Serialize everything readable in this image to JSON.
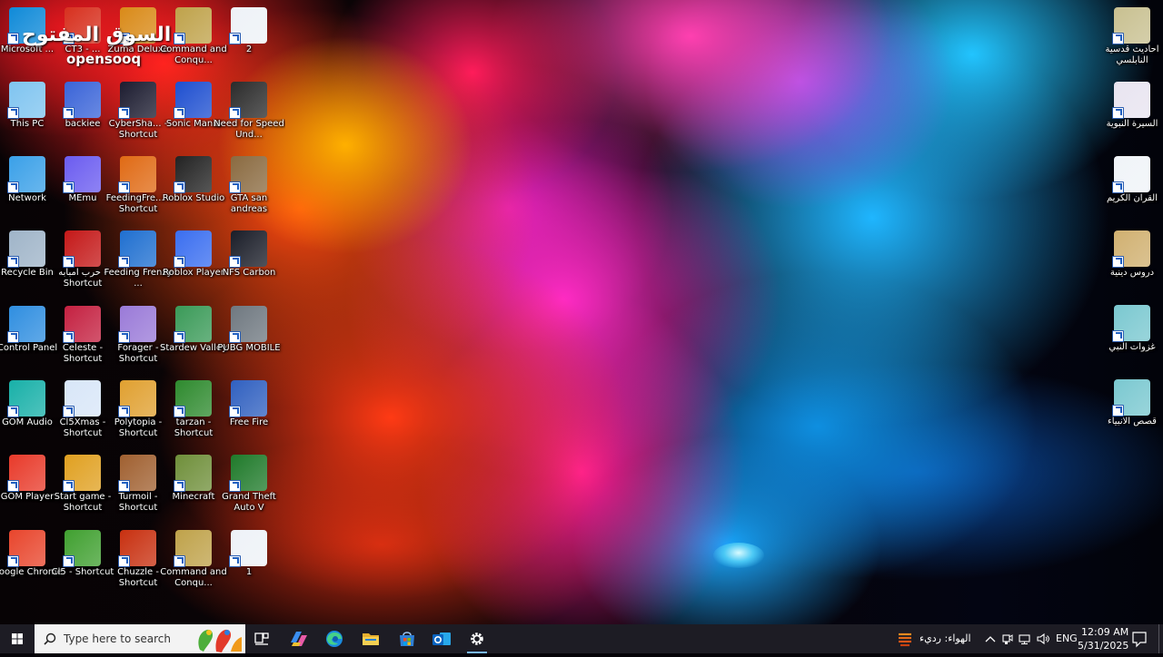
{
  "watermark": {
    "arabic": "السوق المفتوح",
    "latin": "opensooq"
  },
  "desktop": {
    "icons": [
      {
        "label": "Microsoft ...",
        "color": "#0f8ad8"
      },
      {
        "label": "CT3 - ...",
        "color": "#d7301e"
      },
      {
        "label": "Zuma Deluxe",
        "color": "#d98a18"
      },
      {
        "label": "Command and Conqu...",
        "color": "#bfa24a"
      },
      {
        "label": "2",
        "color": "#eef2f7"
      },
      {
        "label": "This PC",
        "color": "#7fc4f0"
      },
      {
        "label": "backiee",
        "color": "#3a64d8"
      },
      {
        "label": "CyberSha... - Shortcut",
        "color": "#1c1c30"
      },
      {
        "label": "Sonic Mania",
        "color": "#1e4fd0"
      },
      {
        "label": "Need for Speed Und...",
        "color": "#2b2b2b"
      },
      {
        "label": "Network",
        "color": "#3aa0e8"
      },
      {
        "label": "MEmu",
        "color": "#6b5cf0"
      },
      {
        "label": "FeedingFre... - Shortcut",
        "color": "#e06a14"
      },
      {
        "label": "Roblox Studio",
        "color": "#222222"
      },
      {
        "label": "GTA san andreas",
        "color": "#8a6a40"
      },
      {
        "label": "Recycle Bin",
        "color": "#9fb4c8"
      },
      {
        "label": "حرب امبابه - Shortcut",
        "color": "#c41818"
      },
      {
        "label": "Feeding Frenzy ...",
        "color": "#1f6fd0"
      },
      {
        "label": "Roblox Player",
        "color": "#3a6ef0"
      },
      {
        "label": "NFS Carbon",
        "color": "#1a1d28"
      },
      {
        "label": "Control Panel",
        "color": "#2f8ee0"
      },
      {
        "label": "Celeste - Shortcut",
        "color": "#c42040"
      },
      {
        "label": "Forager - Shortcut",
        "color": "#9a7ad8"
      },
      {
        "label": "Stardew Valley",
        "color": "#3a9a58"
      },
      {
        "label": "PUBG MOBILE",
        "color": "#6f7880"
      },
      {
        "label": "GOM Audio",
        "color": "#18b0a8"
      },
      {
        "label": "Cl5Xmas - Shortcut",
        "color": "#d8e6f8"
      },
      {
        "label": "Polytopia - Shortcut",
        "color": "#e0a030"
      },
      {
        "label": "tarzan - Shortcut",
        "color": "#2e8a2e"
      },
      {
        "label": "Free Fire",
        "color": "#3060c0"
      },
      {
        "label": "GOM Player",
        "color": "#e83a2a"
      },
      {
        "label": "Start game - Shortcut",
        "color": "#e0a020"
      },
      {
        "label": "Turmoil - Shortcut",
        "color": "#a06030"
      },
      {
        "label": "Minecraft",
        "color": "#6f8f3a"
      },
      {
        "label": "Grand Theft Auto V",
        "color": "#1f7a2a"
      },
      {
        "label": "Google Chrome",
        "color": "#e8452c"
      },
      {
        "label": "Cl5 - Shortcut",
        "color": "#40a030"
      },
      {
        "label": "Chuzzle - Shortcut",
        "color": "#c83010"
      },
      {
        "label": "Command and Conqu...",
        "color": "#bfa24a"
      },
      {
        "label": "1",
        "color": "#eef2f7"
      }
    ],
    "right_icons": [
      {
        "label": "احاديث قدسية النابلسي",
        "color": "#c8c090"
      },
      {
        "label": "السيرة النبوية",
        "color": "#e8e4f0"
      },
      {
        "label": "القرآن الكريم",
        "color": "#f0f4f8"
      },
      {
        "label": "دروس دينية",
        "color": "#d0b070"
      },
      {
        "label": "غزوات النبي",
        "color": "#7ac8d0"
      },
      {
        "label": "قصص الانبياء",
        "color": "#7ac8d0"
      }
    ]
  },
  "taskbar": {
    "search_placeholder": "Type here to search",
    "pins": [
      {
        "name": "task-view-icon"
      },
      {
        "name": "copilot-icon"
      },
      {
        "name": "edge-icon"
      },
      {
        "name": "file-explorer-icon"
      },
      {
        "name": "microsoft-store-icon"
      },
      {
        "name": "outlook-icon"
      },
      {
        "name": "settings-icon"
      }
    ],
    "weather_text": "الهواء: رديء",
    "language": "ENG",
    "time": "12:09 AM",
    "date": "5/31/2025"
  },
  "colors": {
    "taskbar": "#1d1c24",
    "search_bg": "#f3f3f3",
    "accent": "#79b8ff"
  }
}
